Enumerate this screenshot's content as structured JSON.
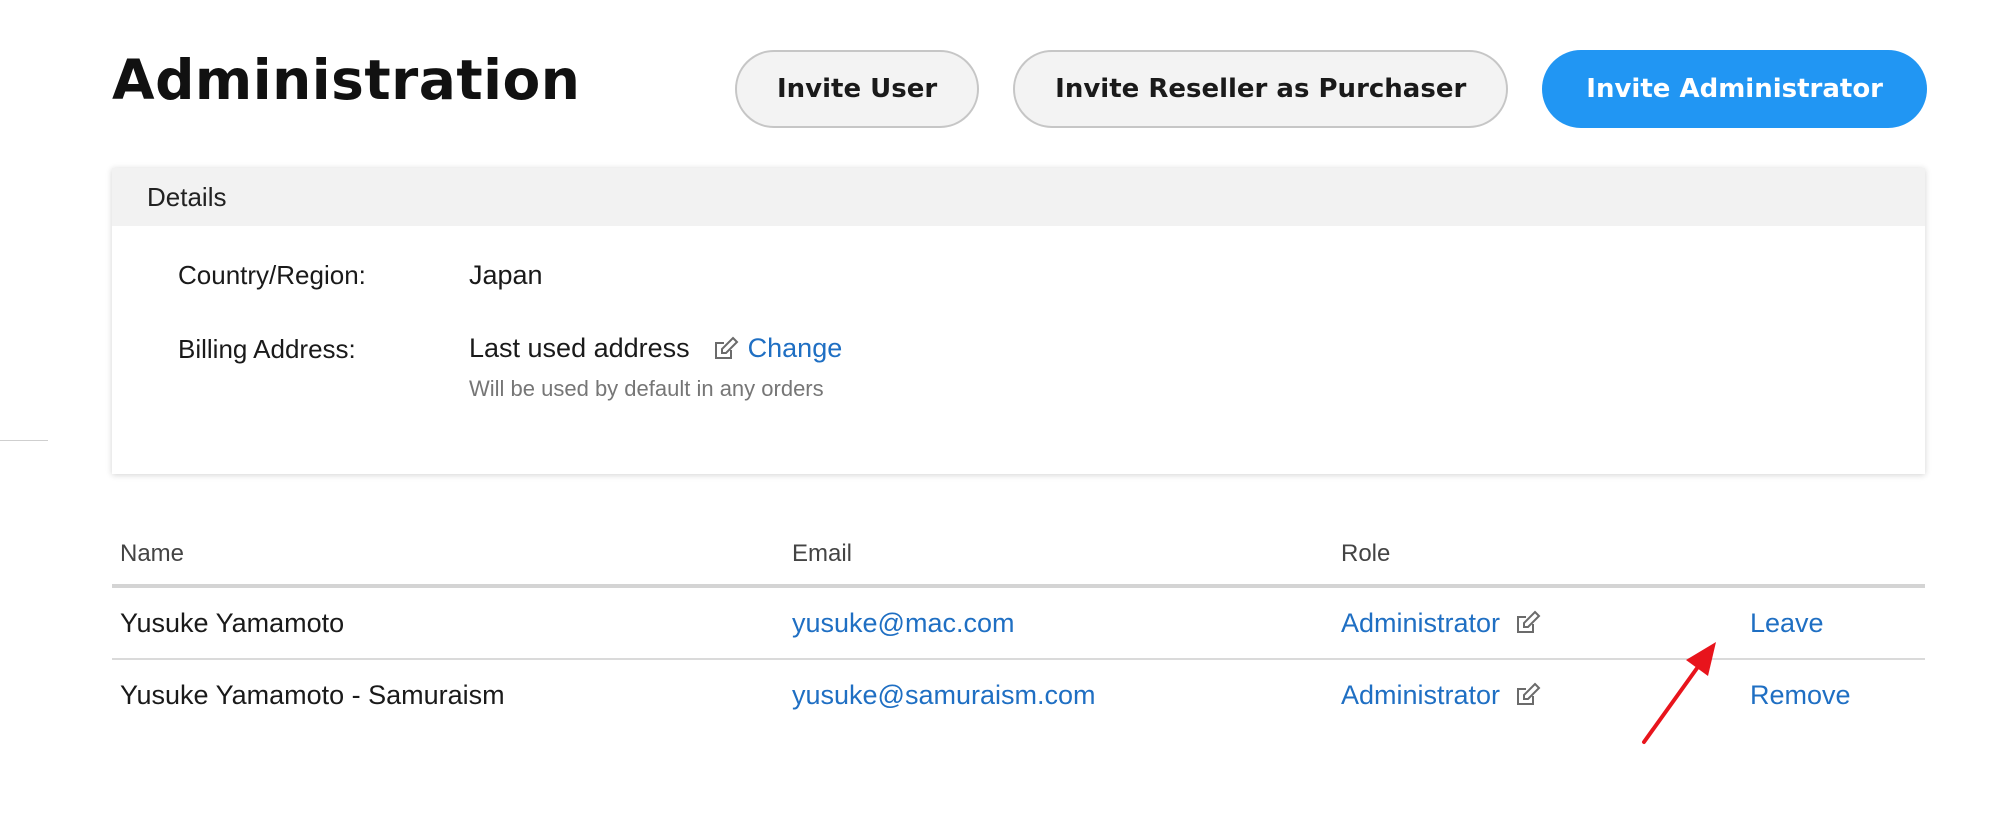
{
  "page": {
    "title": "Administration"
  },
  "actions": {
    "invite_user": "Invite User",
    "invite_reseller": "Invite Reseller as Purchaser",
    "invite_admin": "Invite Administrator"
  },
  "details": {
    "header": "Details",
    "country_label": "Country/Region:",
    "country_value": "Japan",
    "billing_label": "Billing Address:",
    "billing_value": "Last used address",
    "change_label": "Change",
    "billing_note": "Will be used by default in any orders"
  },
  "table": {
    "columns": [
      "Name",
      "Email",
      "Role"
    ],
    "rows": [
      {
        "name": "Yusuke Yamamoto",
        "email": "yusuke@mac.com",
        "role": "Administrator",
        "action": "Leave"
      },
      {
        "name": "Yusuke Yamamoto - Samuraism",
        "email": "yusuke@samuraism.com",
        "role": "Administrator",
        "action": "Remove"
      }
    ]
  },
  "colors": {
    "accent": "#2196f3",
    "link": "#1f6fc3",
    "annotation": "#e8141c"
  },
  "icons": {
    "edit": "edit-icon",
    "annotation": "red-arrow-icon"
  }
}
